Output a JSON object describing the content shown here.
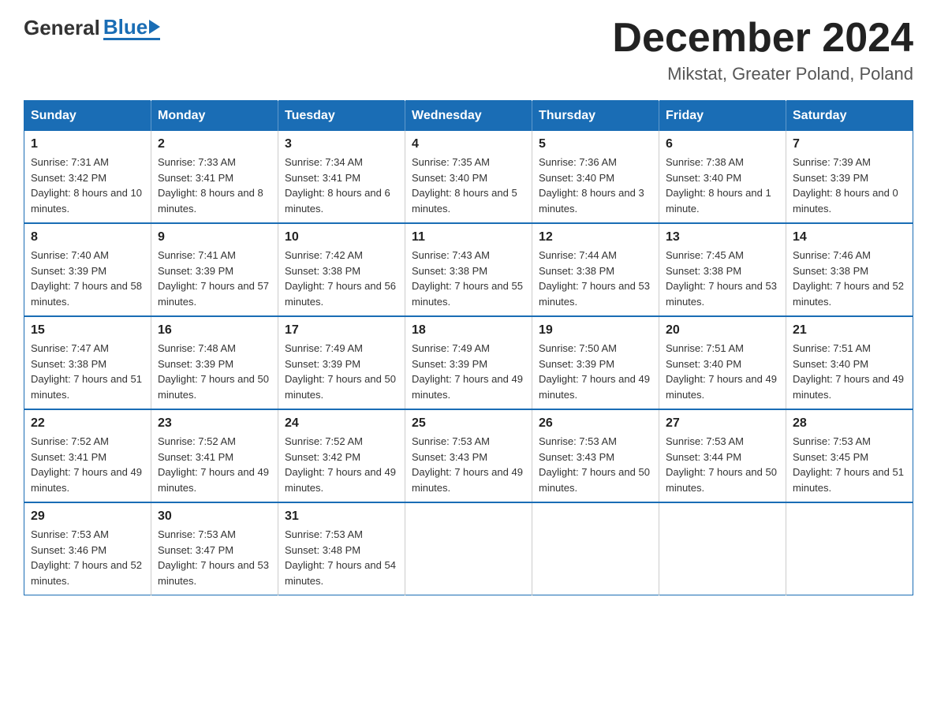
{
  "header": {
    "logo_general": "General",
    "logo_blue": "Blue",
    "month_title": "December 2024",
    "subtitle": "Mikstat, Greater Poland, Poland"
  },
  "days_of_week": [
    "Sunday",
    "Monday",
    "Tuesday",
    "Wednesday",
    "Thursday",
    "Friday",
    "Saturday"
  ],
  "weeks": [
    [
      {
        "day": "1",
        "sunrise": "7:31 AM",
        "sunset": "3:42 PM",
        "daylight": "8 hours and 10 minutes."
      },
      {
        "day": "2",
        "sunrise": "7:33 AM",
        "sunset": "3:41 PM",
        "daylight": "8 hours and 8 minutes."
      },
      {
        "day": "3",
        "sunrise": "7:34 AM",
        "sunset": "3:41 PM",
        "daylight": "8 hours and 6 minutes."
      },
      {
        "day": "4",
        "sunrise": "7:35 AM",
        "sunset": "3:40 PM",
        "daylight": "8 hours and 5 minutes."
      },
      {
        "day": "5",
        "sunrise": "7:36 AM",
        "sunset": "3:40 PM",
        "daylight": "8 hours and 3 minutes."
      },
      {
        "day": "6",
        "sunrise": "7:38 AM",
        "sunset": "3:40 PM",
        "daylight": "8 hours and 1 minute."
      },
      {
        "day": "7",
        "sunrise": "7:39 AM",
        "sunset": "3:39 PM",
        "daylight": "8 hours and 0 minutes."
      }
    ],
    [
      {
        "day": "8",
        "sunrise": "7:40 AM",
        "sunset": "3:39 PM",
        "daylight": "7 hours and 58 minutes."
      },
      {
        "day": "9",
        "sunrise": "7:41 AM",
        "sunset": "3:39 PM",
        "daylight": "7 hours and 57 minutes."
      },
      {
        "day": "10",
        "sunrise": "7:42 AM",
        "sunset": "3:38 PM",
        "daylight": "7 hours and 56 minutes."
      },
      {
        "day": "11",
        "sunrise": "7:43 AM",
        "sunset": "3:38 PM",
        "daylight": "7 hours and 55 minutes."
      },
      {
        "day": "12",
        "sunrise": "7:44 AM",
        "sunset": "3:38 PM",
        "daylight": "7 hours and 53 minutes."
      },
      {
        "day": "13",
        "sunrise": "7:45 AM",
        "sunset": "3:38 PM",
        "daylight": "7 hours and 53 minutes."
      },
      {
        "day": "14",
        "sunrise": "7:46 AM",
        "sunset": "3:38 PM",
        "daylight": "7 hours and 52 minutes."
      }
    ],
    [
      {
        "day": "15",
        "sunrise": "7:47 AM",
        "sunset": "3:38 PM",
        "daylight": "7 hours and 51 minutes."
      },
      {
        "day": "16",
        "sunrise": "7:48 AM",
        "sunset": "3:39 PM",
        "daylight": "7 hours and 50 minutes."
      },
      {
        "day": "17",
        "sunrise": "7:49 AM",
        "sunset": "3:39 PM",
        "daylight": "7 hours and 50 minutes."
      },
      {
        "day": "18",
        "sunrise": "7:49 AM",
        "sunset": "3:39 PM",
        "daylight": "7 hours and 49 minutes."
      },
      {
        "day": "19",
        "sunrise": "7:50 AM",
        "sunset": "3:39 PM",
        "daylight": "7 hours and 49 minutes."
      },
      {
        "day": "20",
        "sunrise": "7:51 AM",
        "sunset": "3:40 PM",
        "daylight": "7 hours and 49 minutes."
      },
      {
        "day": "21",
        "sunrise": "7:51 AM",
        "sunset": "3:40 PM",
        "daylight": "7 hours and 49 minutes."
      }
    ],
    [
      {
        "day": "22",
        "sunrise": "7:52 AM",
        "sunset": "3:41 PM",
        "daylight": "7 hours and 49 minutes."
      },
      {
        "day": "23",
        "sunrise": "7:52 AM",
        "sunset": "3:41 PM",
        "daylight": "7 hours and 49 minutes."
      },
      {
        "day": "24",
        "sunrise": "7:52 AM",
        "sunset": "3:42 PM",
        "daylight": "7 hours and 49 minutes."
      },
      {
        "day": "25",
        "sunrise": "7:53 AM",
        "sunset": "3:43 PM",
        "daylight": "7 hours and 49 minutes."
      },
      {
        "day": "26",
        "sunrise": "7:53 AM",
        "sunset": "3:43 PM",
        "daylight": "7 hours and 50 minutes."
      },
      {
        "day": "27",
        "sunrise": "7:53 AM",
        "sunset": "3:44 PM",
        "daylight": "7 hours and 50 minutes."
      },
      {
        "day": "28",
        "sunrise": "7:53 AM",
        "sunset": "3:45 PM",
        "daylight": "7 hours and 51 minutes."
      }
    ],
    [
      {
        "day": "29",
        "sunrise": "7:53 AM",
        "sunset": "3:46 PM",
        "daylight": "7 hours and 52 minutes."
      },
      {
        "day": "30",
        "sunrise": "7:53 AM",
        "sunset": "3:47 PM",
        "daylight": "7 hours and 53 minutes."
      },
      {
        "day": "31",
        "sunrise": "7:53 AM",
        "sunset": "3:48 PM",
        "daylight": "7 hours and 54 minutes."
      },
      null,
      null,
      null,
      null
    ]
  ],
  "labels": {
    "sunrise": "Sunrise:",
    "sunset": "Sunset:",
    "daylight": "Daylight:"
  }
}
